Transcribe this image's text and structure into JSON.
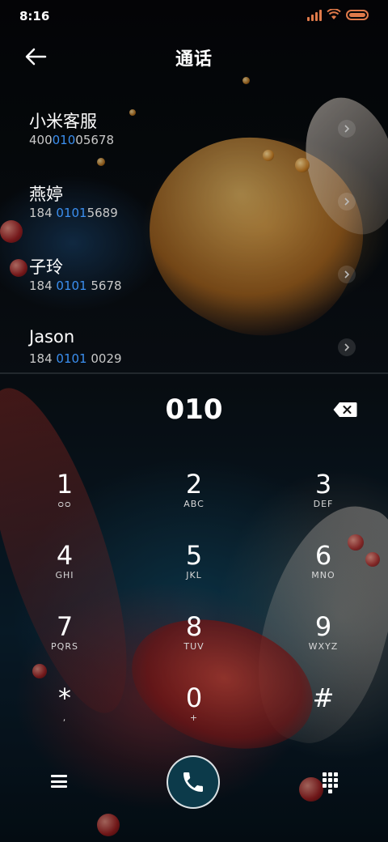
{
  "status_bar": {
    "time": "8:16",
    "icons": [
      "signal-icon",
      "wifi-icon",
      "battery-icon"
    ],
    "icon_color": "#e07a4a"
  },
  "header": {
    "title": "通话",
    "back_icon": "arrow-left-icon"
  },
  "contacts": [
    {
      "name": "小米客服",
      "number_pre": "400",
      "number_match": "010",
      "number_post": "05678"
    },
    {
      "name": "燕婷",
      "number_pre": "184 ",
      "number_match": "0101",
      "number_post": "5689"
    },
    {
      "name": "子玲",
      "number_pre": "184 ",
      "number_match": "0101",
      "number_post": " 5678"
    },
    {
      "name": "Jason",
      "number_pre": "184 ",
      "number_match": "0101",
      "number_post": " 0029"
    }
  ],
  "dial": {
    "input": "010",
    "backspace_icon": "backspace-icon"
  },
  "keypad": [
    {
      "digit": "1",
      "letters": "ᴑᴑ"
    },
    {
      "digit": "2",
      "letters": "ABC"
    },
    {
      "digit": "3",
      "letters": "DEF"
    },
    {
      "digit": "4",
      "letters": "GHI"
    },
    {
      "digit": "5",
      "letters": "JKL"
    },
    {
      "digit": "6",
      "letters": "MNO"
    },
    {
      "digit": "7",
      "letters": "PQRS"
    },
    {
      "digit": "8",
      "letters": "TUV"
    },
    {
      "digit": "9",
      "letters": "WXYZ"
    },
    {
      "digit": "*",
      "letters": ","
    },
    {
      "digit": "0",
      "letters": "+"
    },
    {
      "digit": "#",
      "letters": ""
    }
  ],
  "bottom_bar": {
    "menu_icon": "menu-icon",
    "call_icon": "phone-icon",
    "dialpad_icon": "dialpad-icon"
  },
  "colors": {
    "match_highlight": "#3b8ff0",
    "call_button_bg": "#0c3a4a"
  }
}
